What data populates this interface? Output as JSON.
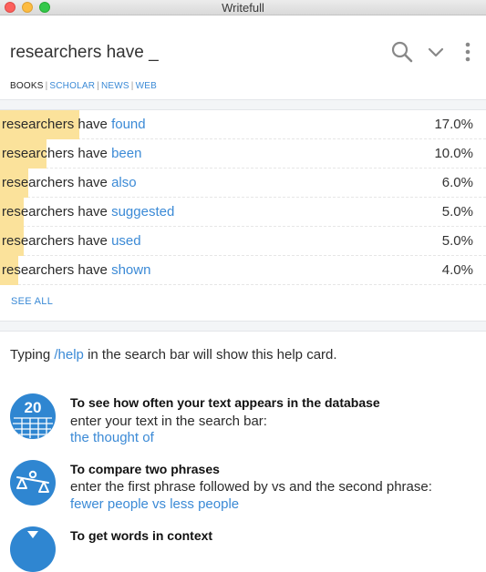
{
  "window": {
    "title": "Writefull"
  },
  "search": {
    "query": "researchers have _"
  },
  "toolbar": {
    "search_icon": "search-icon",
    "chevron_icon": "chevron-down-icon",
    "more_icon": "more-vertical-icon"
  },
  "sources": [
    {
      "label": "BOOKS",
      "active": true
    },
    {
      "label": "SCHOLAR",
      "active": false
    },
    {
      "label": "NEWS",
      "active": false
    },
    {
      "label": "WEB",
      "active": false
    }
  ],
  "source_separator": "|",
  "results": {
    "rows": [
      {
        "base": "researchers have",
        "next": "found",
        "percent_label": "17.0%",
        "percent": 17.0
      },
      {
        "base": "researchers have",
        "next": "been",
        "percent_label": "10.0%",
        "percent": 10.0
      },
      {
        "base": "researchers have",
        "next": "also",
        "percent_label": "6.0%",
        "percent": 6.0
      },
      {
        "base": "researchers have",
        "next": "suggested",
        "percent_label": "5.0%",
        "percent": 5.0
      },
      {
        "base": "researchers have",
        "next": "used",
        "percent_label": "5.0%",
        "percent": 5.0
      },
      {
        "base": "researchers have",
        "next": "shown",
        "percent_label": "4.0%",
        "percent": 4.0
      }
    ],
    "see_all": "SEE ALL"
  },
  "help": {
    "intro_before": "Typing ",
    "intro_cmd": "/help",
    "intro_after": " in the search bar will show this help card.",
    "cards": [
      {
        "icon": "frequency-20-icon",
        "icon_number": "20",
        "title": "To see how often your text appears in the database",
        "desc": "enter your text in the search bar:",
        "example": "the thought of"
      },
      {
        "icon": "balance-scale-icon",
        "title": "To compare two phrases",
        "desc": "enter the first phrase followed by vs and the second phrase:",
        "example": "fewer people vs less people"
      },
      {
        "icon": "context-arrow-icon",
        "title": "To get words in context",
        "desc": "",
        "example": ""
      }
    ]
  },
  "colors": {
    "accent": "#3b8ad6",
    "bar": "#fbe29b",
    "icon_bg": "#2f86d1"
  }
}
